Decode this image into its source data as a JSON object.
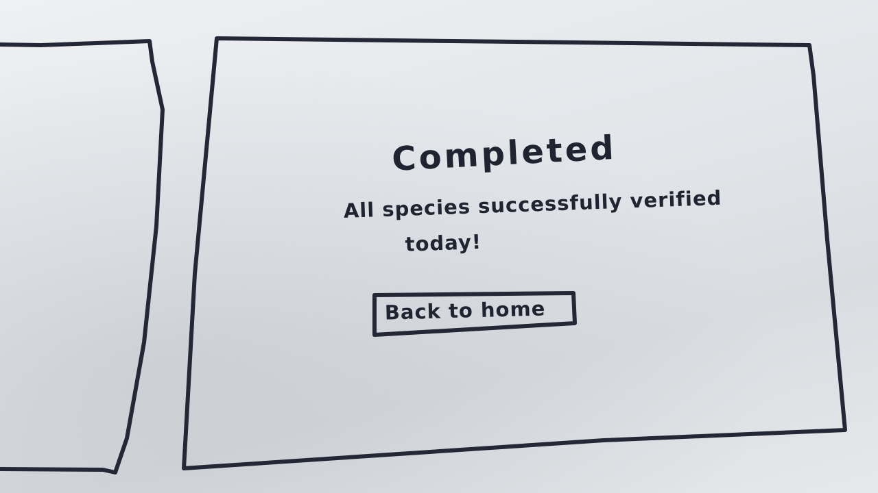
{
  "screen": {
    "title": "Completed",
    "message_line1": "All species successfully verified",
    "message_line2": "today!",
    "back_button_label": "Back to home"
  }
}
